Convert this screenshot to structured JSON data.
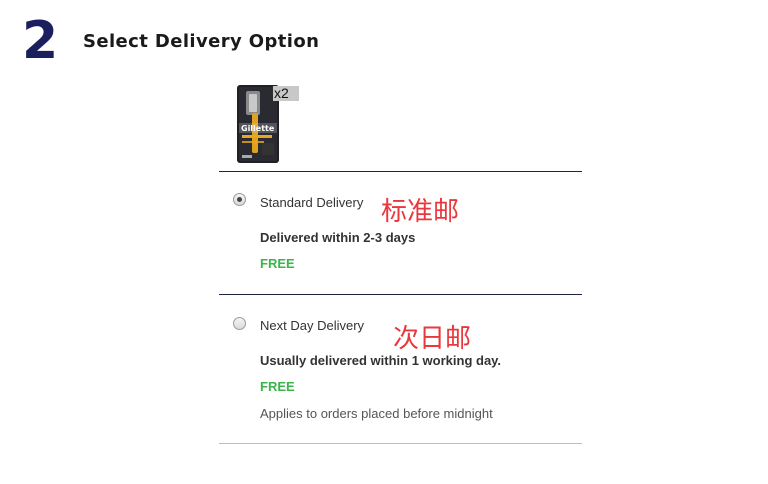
{
  "header": {
    "step_number": "2",
    "title": "Select Delivery Option"
  },
  "product": {
    "image_icon": "razor-product-image",
    "quantity": "x2"
  },
  "options": [
    {
      "label": "Standard Delivery",
      "selected": true,
      "description": "Delivered within 2-3 days",
      "price": "FREE",
      "annotation": "标准邮"
    },
    {
      "label": "Next Day Delivery",
      "selected": false,
      "description": "Usually delivered within 1 working day.",
      "price": "FREE",
      "note": "Applies to orders placed before midnight",
      "annotation": "次日邮"
    }
  ],
  "colors": {
    "step_number": "#1b1f5e",
    "price": "#3cb44b",
    "annotation": "#e8383d",
    "divider": "#1f2440"
  }
}
